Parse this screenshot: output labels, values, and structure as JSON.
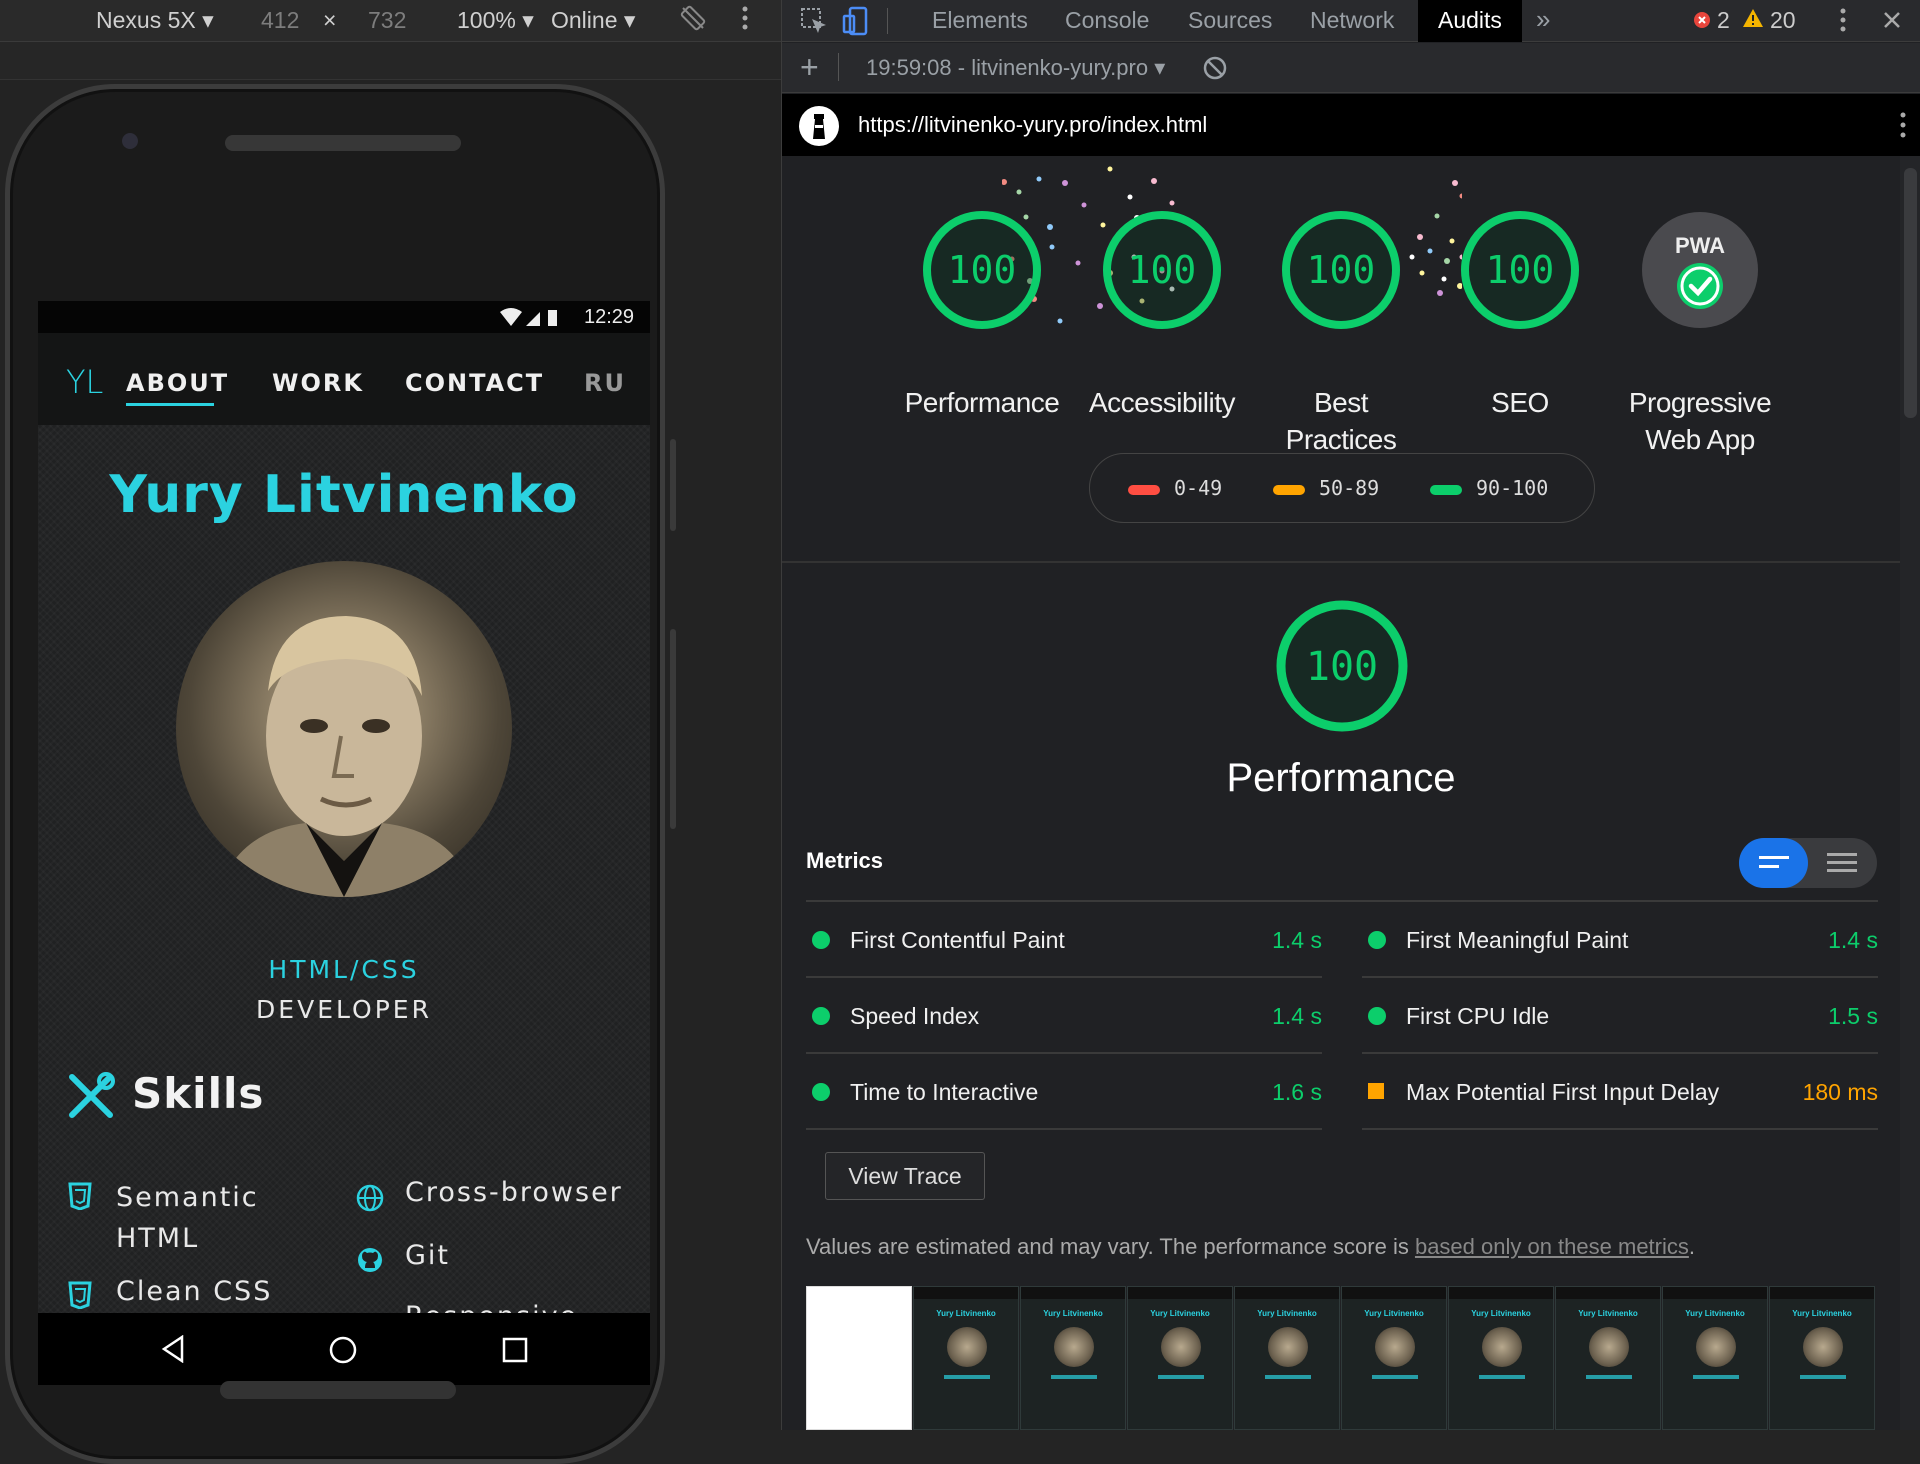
{
  "device_toolbar": {
    "device": "Nexus 5X",
    "width": "412",
    "times": "×",
    "height": "732",
    "zoom": "100%",
    "network": "Online"
  },
  "phone": {
    "status": {
      "time": "12:29"
    },
    "nav": {
      "logo": "YL",
      "items": [
        "ABOUT",
        "WORK",
        "CONTACT",
        "RU"
      ]
    },
    "name": "Yury Litvinenko",
    "role_line1": "HTML/CSS",
    "role_line2": "DEVELOPER",
    "skills_title": "Skills",
    "skills": {
      "semantic_l1": "Semantic",
      "semantic_l2": "HTML",
      "clean_css": "Clean CSS",
      "cross_browser": "Cross-browser",
      "git": "Git",
      "responsive": "Responsive"
    }
  },
  "devtools": {
    "tabs": [
      "Elements",
      "Console",
      "Sources",
      "Network",
      "Audits"
    ],
    "active_tab": "Audits",
    "errors": "2",
    "warnings": "20",
    "report_select": "19:59:08 - litvinenko-yury.pro",
    "url": "https://litvinenko-yury.pro/index.html"
  },
  "categories": [
    {
      "label": "Performance",
      "score": "100"
    },
    {
      "label": "Accessibility",
      "score": "100"
    },
    {
      "label": "Best Practices",
      "score": "100"
    },
    {
      "label": "SEO",
      "score": "100"
    },
    {
      "label": "Progressive Web App",
      "badge": "PWA"
    }
  ],
  "legend": [
    {
      "range": "0-49",
      "color": "#ff4e42"
    },
    {
      "range": "50-89",
      "color": "#ffa400"
    },
    {
      "range": "90-100",
      "color": "#0cce6b"
    }
  ],
  "performance": {
    "score": "100",
    "title": "Performance",
    "metrics_heading": "Metrics",
    "metrics": [
      {
        "name": "First Contentful Paint",
        "value": "1.4 s",
        "status": "pass"
      },
      {
        "name": "First Meaningful Paint",
        "value": "1.4 s",
        "status": "pass"
      },
      {
        "name": "Speed Index",
        "value": "1.4 s",
        "status": "pass"
      },
      {
        "name": "First CPU Idle",
        "value": "1.5 s",
        "status": "pass"
      },
      {
        "name": "Time to Interactive",
        "value": "1.6 s",
        "status": "pass"
      },
      {
        "name": "Max Potential First Input Delay",
        "value": "180 ms",
        "status": "average"
      }
    ],
    "view_trace": "View Trace",
    "note": "Values are estimated and may vary. The performance score is ",
    "note_link": "based only on these metrics",
    "note_end": ".",
    "thumb_caption": "Yury Litvinenko"
  },
  "colors": {
    "pass": "#0cce6b",
    "average": "#ffa400",
    "fail": "#ff4e42",
    "accent": "#2bd2e0"
  }
}
